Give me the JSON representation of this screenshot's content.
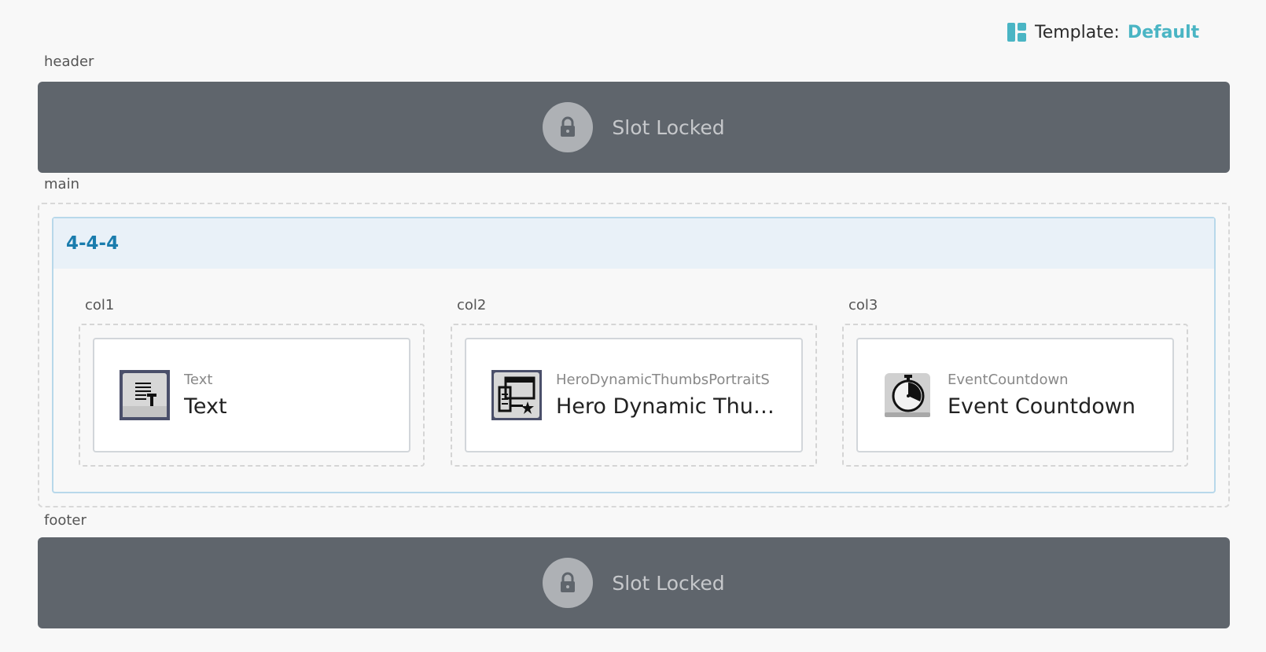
{
  "template": {
    "label": "Template:",
    "value": "Default"
  },
  "slots": {
    "header": {
      "label": "header",
      "locked_text": "Slot Locked"
    },
    "main": {
      "label": "main"
    },
    "footer": {
      "label": "footer",
      "locked_text": "Slot Locked"
    }
  },
  "layout": {
    "title": "4-4-4",
    "columns": [
      {
        "label": "col1",
        "widget": {
          "type": "Text",
          "name": "Text",
          "icon": "text-widget-icon"
        }
      },
      {
        "label": "col2",
        "widget": {
          "type": "HeroDynamicThumbsPortraitS",
          "name": "Hero Dynamic Thumbs Portrait Slider",
          "icon": "hero-dynamic-thumbs-icon"
        }
      },
      {
        "label": "col3",
        "widget": {
          "type": "EventCountdown",
          "name": "Event Countdown",
          "icon": "stopwatch-icon"
        }
      }
    ]
  },
  "colors": {
    "accent": "#4ab5c4",
    "layout_title": "#1a7cad",
    "locked_bg": "#5f656c"
  }
}
